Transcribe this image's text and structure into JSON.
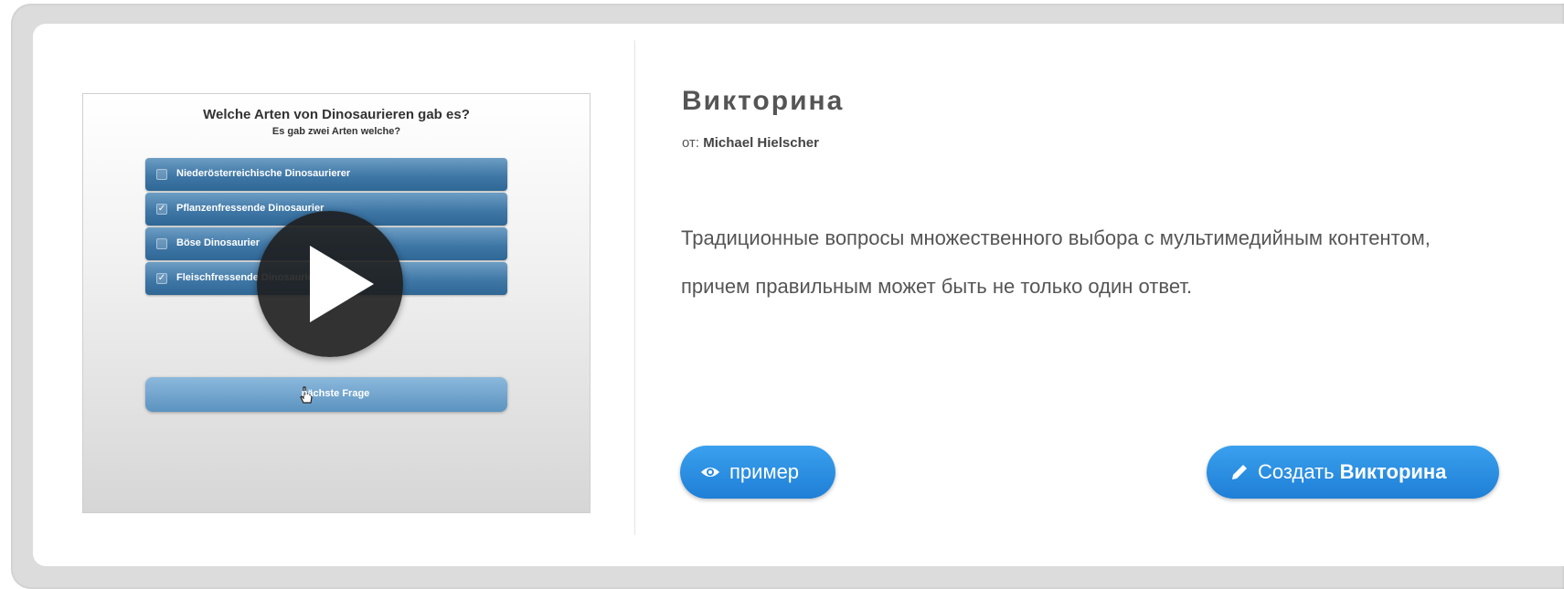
{
  "preview": {
    "question": "Welche Arten von Dinosaurieren gab es?",
    "subquestion": "Es gab zwei Arten welche?",
    "answers": [
      {
        "label": "Niederösterreichische Dinosaurierer",
        "checked": false
      },
      {
        "label": "Pflanzenfressende Dinosaurier",
        "checked": true
      },
      {
        "label": "Böse Dinosaurier",
        "checked": false
      },
      {
        "label": "Fleischfressende Dinosaurier",
        "checked": true
      }
    ],
    "next_label": "nächste Frage",
    "play_icon": "play-icon"
  },
  "content": {
    "title": "Викторина",
    "author_prefix": "от:",
    "author_name": "Michael Hielscher",
    "description": "Традиционные вопросы множественного выбора с мультимедийным контентом, причем правильным может быть не только один ответ."
  },
  "buttons": {
    "example_label": "пример",
    "example_icon": "eye-icon",
    "create_label": "Создать",
    "create_type": "Викторина",
    "create_icon": "pencil-icon"
  },
  "colors": {
    "accent": "#2a8ae0",
    "answer_bar": "#3f77a6",
    "text": "#555555"
  }
}
